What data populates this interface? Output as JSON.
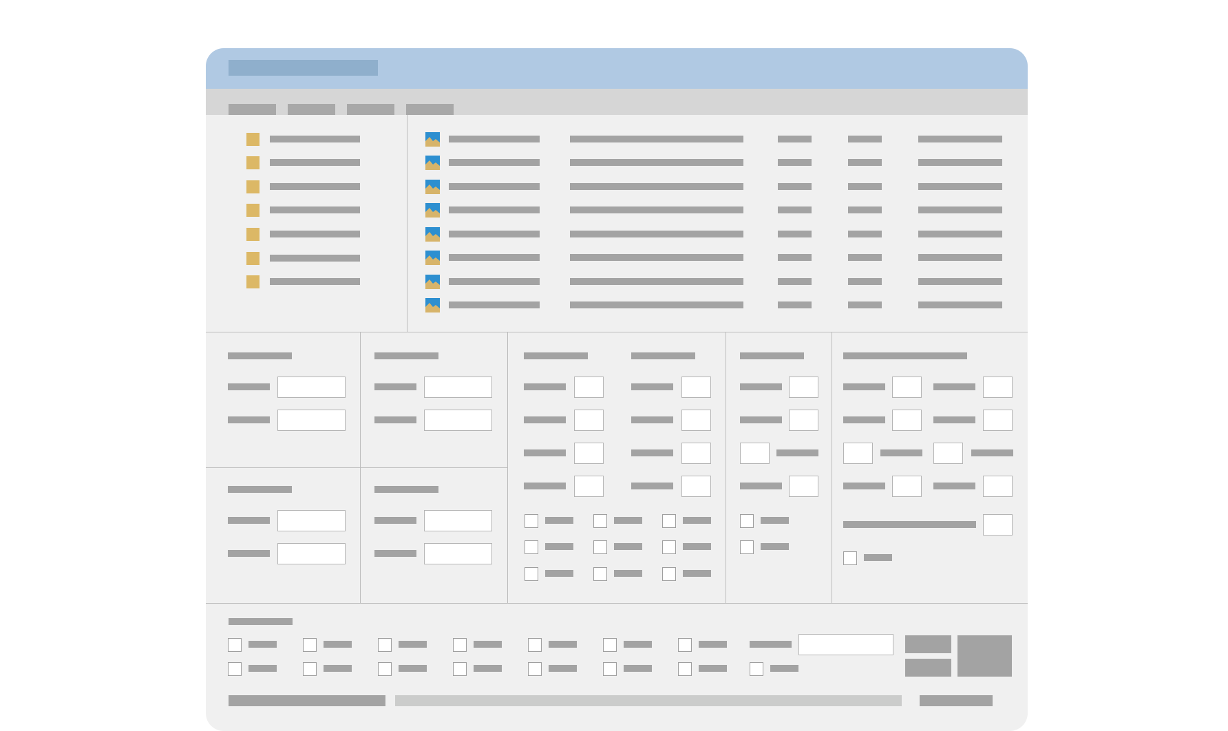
{
  "window": {
    "title": "",
    "menu": [
      "",
      "",
      "",
      ""
    ]
  },
  "folders": [
    "",
    "",
    "",
    "",
    "",
    "",
    ""
  ],
  "files": {
    "columns": [
      "",
      "",
      "",
      "",
      ""
    ],
    "rows": [
      [
        "",
        "",
        "",
        "",
        ""
      ],
      [
        "",
        "",
        "",
        "",
        ""
      ],
      [
        "",
        "",
        "",
        "",
        ""
      ],
      [
        "",
        "",
        "",
        "",
        ""
      ],
      [
        "",
        "",
        "",
        "",
        ""
      ],
      [
        "",
        "",
        "",
        "",
        ""
      ],
      [
        "",
        "",
        "",
        "",
        ""
      ],
      [
        "",
        "",
        "",
        "",
        ""
      ]
    ]
  },
  "panels": {
    "panel_a": {
      "title": "",
      "fields": [
        {
          "label": "",
          "value": ""
        },
        {
          "label": "",
          "value": ""
        }
      ]
    },
    "panel_b": {
      "title": "",
      "fields": [
        {
          "label": "",
          "value": ""
        },
        {
          "label": "",
          "value": ""
        }
      ]
    },
    "panel_c": {
      "title": "",
      "fields": [
        {
          "label": "",
          "value": ""
        },
        {
          "label": "",
          "value": ""
        }
      ]
    },
    "panel_d": {
      "title": "",
      "fields": [
        {
          "label": "",
          "value": ""
        },
        {
          "label": "",
          "value": ""
        }
      ]
    },
    "panel_e": {
      "title_left": "",
      "title_right": "",
      "checkboxes": [
        "",
        "",
        "",
        "",
        "",
        "",
        "",
        "",
        ""
      ]
    },
    "panel_f": {
      "title": "",
      "checkboxes": [
        "",
        ""
      ]
    },
    "panel_g": {
      "title": "",
      "checkbox": ""
    }
  },
  "bottom": {
    "title": "",
    "options": [
      "",
      "",
      "",
      "",
      "",
      "",
      "",
      "",
      "",
      "",
      "",
      "",
      "",
      "",
      "",
      ""
    ],
    "field_label": "",
    "field_value": "",
    "status_left": "",
    "status_right": "",
    "progress": 0.0
  },
  "icons": {
    "folder": "folder-icon",
    "image": "image-file-icon"
  },
  "colors": {
    "titlebar": "#b0c9e3",
    "menubar": "#d6d6d6",
    "panel": "#f0f0f0",
    "placeholder": "#a3a3a3",
    "folder": "#dcb866"
  }
}
